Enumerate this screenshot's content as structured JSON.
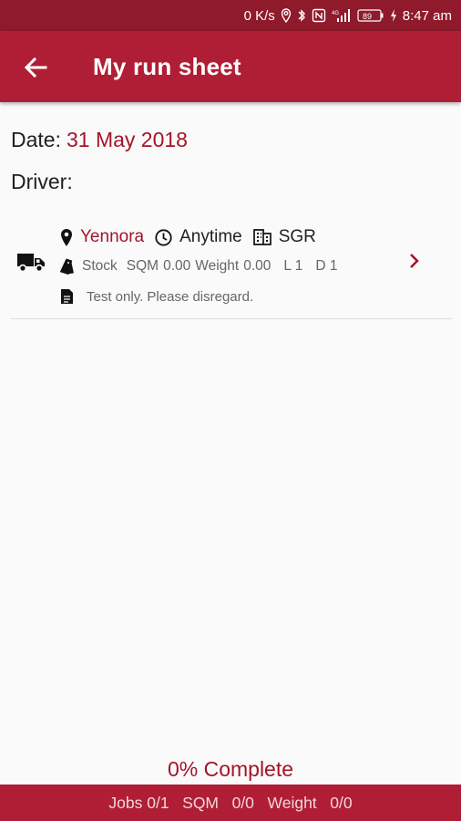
{
  "status_bar": {
    "speed": "0 K/s",
    "battery": "89",
    "time": "8:47 am"
  },
  "app_bar": {
    "title": "My run sheet",
    "back_icon": "arrow-left-icon"
  },
  "header": {
    "date_label": "Date:",
    "date_value": "31 May 2018",
    "driver_label": "Driver:"
  },
  "jobs": [
    {
      "suburb": "Yennora",
      "time_window": "Anytime",
      "code": "SGR",
      "type": "Stock",
      "sqm_label": "SQM",
      "sqm": "0.00",
      "weight_label": "Weight",
      "weight": "0.00",
      "l": "L 1",
      "d": "D 1",
      "note": "Test only. Please disregard."
    }
  ],
  "progress": {
    "complete_text": "0% Complete"
  },
  "footer": {
    "jobs": "Jobs 0/1",
    "sqm": "SQM   0/0",
    "weight": "Weight   0/0"
  },
  "colors": {
    "primary": "#b01e35",
    "primary_dark": "#8e1a2b",
    "accent_text": "#a3142a"
  }
}
